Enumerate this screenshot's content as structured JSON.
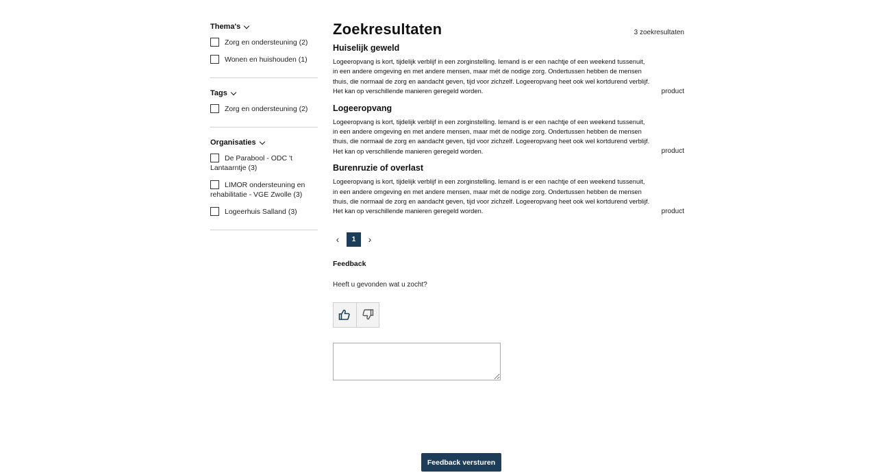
{
  "sidebar": {
    "facets": [
      {
        "title": "Thema's",
        "options": [
          "Zorg en ondersteuning (2)",
          "Wonen en huishouden (1)"
        ]
      },
      {
        "title": "Tags",
        "options": [
          "Zorg en ondersteuning (2)"
        ]
      },
      {
        "title": "Organisaties",
        "options": [
          "De Parabool - ODC 't Lantaarntje (3)",
          "LIMOR ondersteuning en rehabilitatie - VGE Zwolle (3)",
          "Logeerhuis Salland (3)"
        ]
      }
    ]
  },
  "main": {
    "title": "Zoekresultaten",
    "count": "3 zoekresultaten",
    "results": [
      {
        "title": "Huiselijk geweld",
        "description": "Logeeropvang is kort, tijdelijk verblijf in een zorginstelling. Iemand is er een nachtje of een weekend tussenuit, in een andere omgeving en met andere mensen, maar mét de nodige zorg. Ondertussen hebben de mensen thuis, die normaal de zorg en aandacht geven, tijd voor zichzelf. Logeeropvang heet ook wel kortdurend verblijf. Het kan op verschillende manieren geregeld worden.",
        "type": "product"
      },
      {
        "title": "Logeeropvang",
        "description": "Logeeropvang is kort, tijdelijk verblijf in een zorginstelling. Iemand is er een nachtje of een weekend tussenuit, in een andere omgeving en met andere mensen, maar mét de nodige zorg. Ondertussen hebben de mensen thuis, die normaal de zorg en aandacht geven, tijd voor zichzelf. Logeeropvang heet ook wel kortdurend verblijf. Het kan op verschillende manieren geregeld worden.",
        "type": "product"
      },
      {
        "title": "Burenruzie of overlast",
        "description": "Logeeropvang is kort, tijdelijk verblijf in een zorginstelling. Iemand is er een nachtje of een weekend tussenuit, in een andere omgeving en met andere mensen, maar mét de nodige zorg. Ondertussen hebben de mensen thuis, die normaal de zorg en aandacht geven, tijd voor zichzelf. Logeeropvang heet ook wel kortdurend verblijf. Het kan op verschillende manieren geregeld worden.",
        "type": "product"
      }
    ],
    "pagination": {
      "prev": "‹",
      "current": "1",
      "next": "›"
    },
    "feedback": {
      "title": "Feedback",
      "question": "Heeft u gevonden wat u zocht?",
      "thumbs_up_icon": "thumbs-up-icon",
      "thumbs_down_icon": "thumbs-down-icon",
      "textarea_placeholder": "",
      "submit_label": "Feedback versturen"
    }
  },
  "colors": {
    "accent": "#1e3d59"
  }
}
